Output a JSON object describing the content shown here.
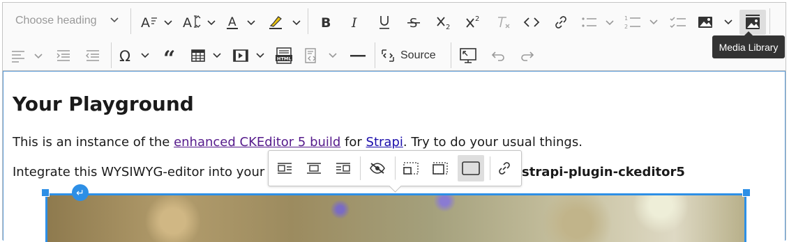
{
  "toolbar": {
    "heading_placeholder": "Choose heading",
    "source_label": "Source",
    "items_row1": [
      "font-size-icon",
      "font-family-icon",
      "font-color-icon",
      "highlight-icon",
      "bold-icon",
      "italic-icon",
      "underline-icon",
      "strikethrough-icon",
      "subscript-icon",
      "superscript-icon",
      "remove-format-icon",
      "code-icon",
      "link-icon",
      "bulleted-list-icon",
      "numbered-list-icon",
      "todo-list-icon",
      "insert-image-icon",
      "media-library-icon"
    ],
    "items_row2": [
      "alignment-icon",
      "indent-icon",
      "outdent-icon",
      "special-characters-icon",
      "blockquote-icon",
      "insert-table-icon",
      "insert-media-icon",
      "html-embed-icon",
      "code-block-icon",
      "horizontal-line-icon",
      "source-icon",
      "fullscreen-icon",
      "undo-icon",
      "redo-icon"
    ]
  },
  "tooltip": {
    "text": "Media Library"
  },
  "content": {
    "heading": "Your Playground",
    "p1_before": "This is an instance of the ",
    "p1_link1": "enhanced CKEditor 5 build",
    "p1_mid": " for ",
    "p1_link2": "Strapi",
    "p1_after": ". Try to do your usual things.",
    "p2_text": "Integrate this WYSIWYG-editor into your S",
    "p2_bold": "strapi-plugin-ckeditor5"
  },
  "image_toolbar": [
    "align-left-wrap-icon",
    "align-center-icon",
    "align-right-wrap-icon",
    "toggle-caption-icon",
    "resize-small-icon",
    "resize-medium-icon",
    "resize-full-icon",
    "link-image-icon"
  ],
  "colors": {
    "selection": "#2d8fe6",
    "toolbar_bg": "#fafafa",
    "tooltip_bg": "#333333"
  }
}
